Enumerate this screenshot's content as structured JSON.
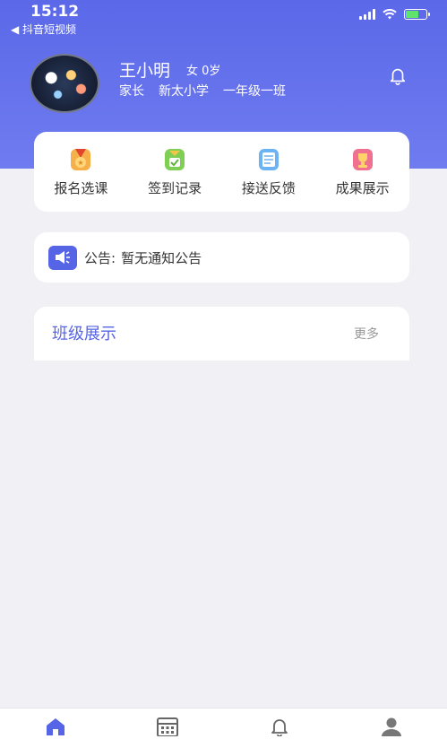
{
  "status_bar": {
    "time": "15:12",
    "back_app": "◀ 抖音短视频",
    "icons": [
      "signal-icon",
      "wifi-icon",
      "battery-icon"
    ]
  },
  "profile": {
    "name": "王小明",
    "gender_age": "女 0岁",
    "role": "家长",
    "school": "新太小学",
    "class": "一年级一班"
  },
  "menu": [
    {
      "label": "报名选课",
      "icon": "medal-icon",
      "color": "#f29a3a"
    },
    {
      "label": "签到记录",
      "icon": "checkin-icon",
      "color": "#6cc24a"
    },
    {
      "label": "接送反馈",
      "icon": "document-icon",
      "color": "#5aa7f0"
    },
    {
      "label": "成果展示",
      "icon": "trophy-icon",
      "color": "#ef5a7a"
    }
  ],
  "notice": {
    "label": "公告:",
    "text": "暂无通知公告"
  },
  "class_showcase": {
    "title": "班级展示",
    "more": "更多"
  },
  "tabbar": {
    "tabs": [
      {
        "icon": "home-icon",
        "active": true
      },
      {
        "icon": "calendar-icon",
        "active": false
      },
      {
        "icon": "bell-icon",
        "active": false
      },
      {
        "icon": "user-icon",
        "active": false
      }
    ]
  },
  "colors": {
    "header": "#5b68e8",
    "accent": "#5664e6",
    "background": "#f1f1f5"
  }
}
